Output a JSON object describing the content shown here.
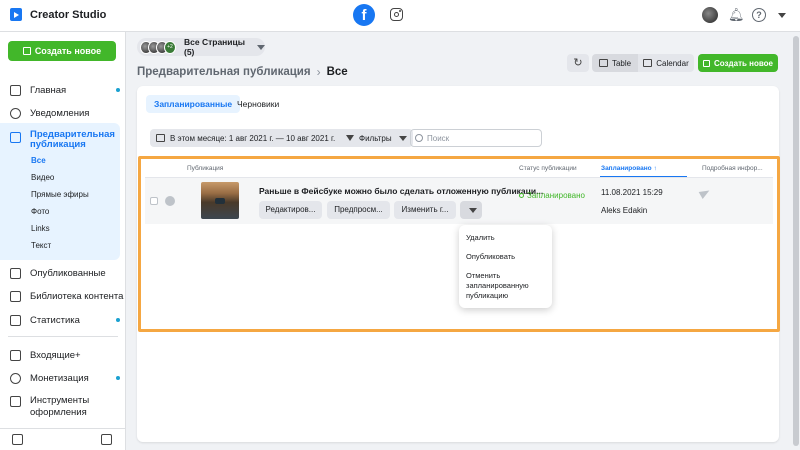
{
  "app": {
    "title": "Creator Studio"
  },
  "sidebar": {
    "create_label": "Создать новое",
    "items": [
      {
        "label": "Главная"
      },
      {
        "label": "Уведомления"
      },
      {
        "label": "Предварительная публикация"
      },
      {
        "label": "Опубликованные"
      },
      {
        "label": "Библиотека контента"
      },
      {
        "label": "Статистика"
      },
      {
        "label": "Входящие+"
      },
      {
        "label": "Монетизация"
      },
      {
        "label": "Инструменты оформления"
      }
    ],
    "subitems": [
      "Все",
      "Видео",
      "Прямые эфиры",
      "Фото",
      "Links",
      "Текст"
    ]
  },
  "header": {
    "pages_label": "Все Страницы (5)",
    "pages_count_badge": "+2",
    "breadcrumb": [
      "Предварительная публикация",
      "Все"
    ],
    "table_label": "Table",
    "calendar_label": "Calendar",
    "create_label": "Создать новое"
  },
  "tabs": [
    {
      "label": "Запланированные",
      "active": true
    },
    {
      "label": "Черновики",
      "active": false
    }
  ],
  "filters": {
    "date_range": "В этом месяце: 1 авг 2021 г. — 10 авг 2021 г.",
    "filters_label": "Фильтры",
    "search_placeholder": "Поиск"
  },
  "table": {
    "columns": [
      "Публикация",
      "Статус публикации",
      "Запланировано ↑",
      "Подробная инфор..."
    ],
    "rows": [
      {
        "title": "Раньше в Фейсбуке можно было сделать отложенную публикаци...",
        "actions": [
          "Редактиров...",
          "Предпросм...",
          "Изменить г..."
        ],
        "status": "Запланировано",
        "scheduled": "11.08.2021 15:29",
        "author": "Aleks Edakin"
      }
    ]
  },
  "dropdown": {
    "items": [
      "Удалить",
      "Опубликовать",
      "Отменить запланированную публикацию"
    ]
  },
  "colors": {
    "accent": "#1877f2",
    "green": "#42b72a",
    "highlight": "#f5a742"
  }
}
